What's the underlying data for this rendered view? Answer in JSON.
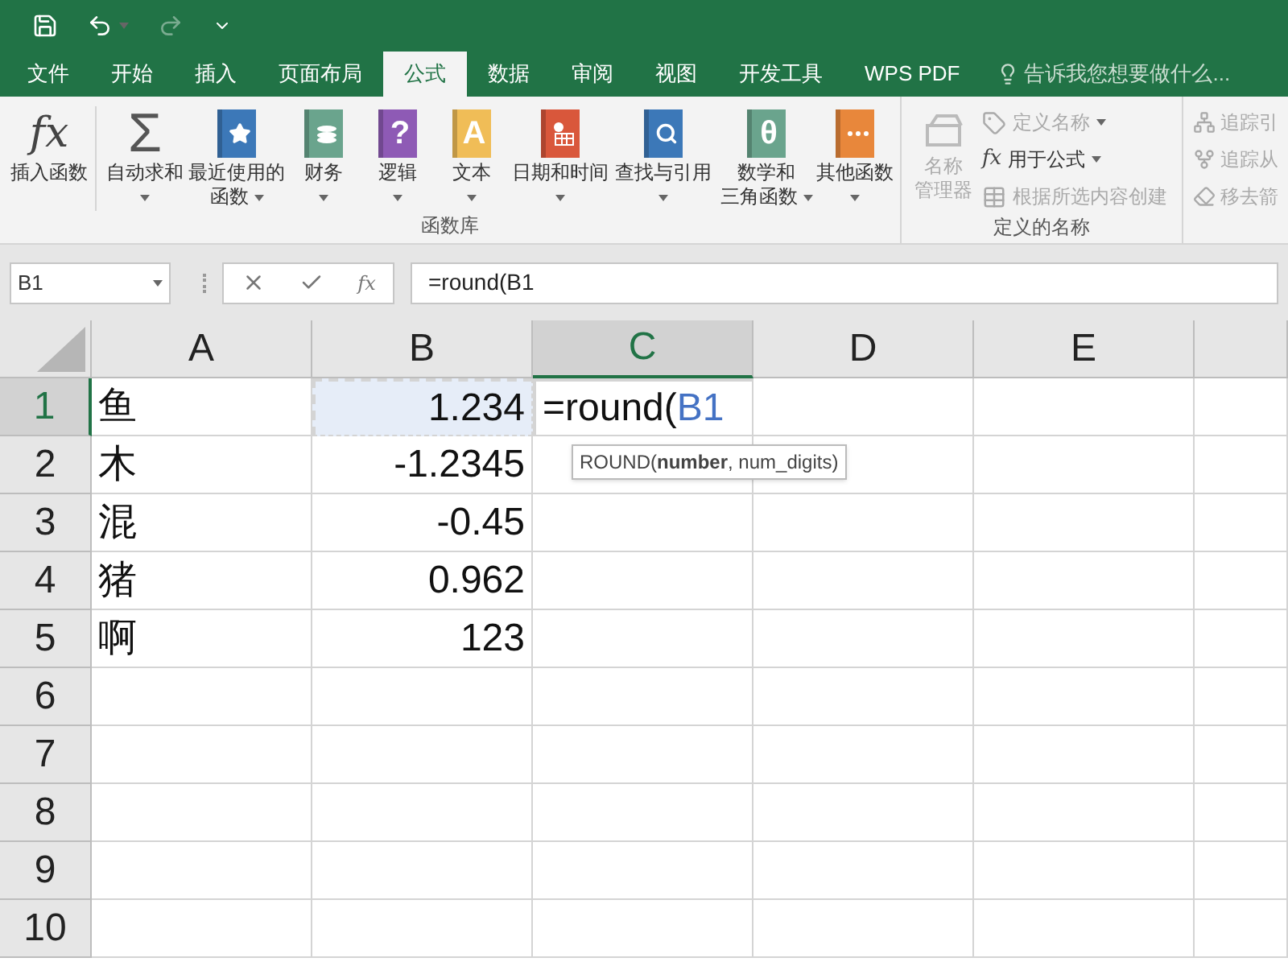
{
  "tabs": [
    {
      "label": "文件",
      "selected": false
    },
    {
      "label": "开始",
      "selected": false
    },
    {
      "label": "插入",
      "selected": false
    },
    {
      "label": "页面布局",
      "selected": false
    },
    {
      "label": "公式",
      "selected": true
    },
    {
      "label": "数据",
      "selected": false
    },
    {
      "label": "审阅",
      "selected": false
    },
    {
      "label": "视图",
      "selected": false
    },
    {
      "label": "开发工具",
      "selected": false
    },
    {
      "label": "WPS PDF",
      "selected": false
    }
  ],
  "tell_me": {
    "placeholder": "告诉我您想要做什么..."
  },
  "ribbon": {
    "function_library": {
      "title": "函数库",
      "items": [
        {
          "kind": "fx",
          "glyph": "fx",
          "lines": [
            "插入函数"
          ],
          "dropdown": false
        },
        {
          "kind": "sigma",
          "glyph": "Σ",
          "lines": [
            "自动求和"
          ],
          "dropdown": true
        },
        {
          "kind": "star",
          "color": "#3c78b8",
          "lines": [
            "最近使用的",
            "函数"
          ],
          "dropdown": true
        },
        {
          "kind": "coins",
          "color": "#6aa48d",
          "lines": [
            "财务"
          ],
          "dropdown": true
        },
        {
          "kind": "glyph",
          "glyph": "?",
          "color": "#8e5ab5",
          "lines": [
            "逻辑"
          ],
          "dropdown": true
        },
        {
          "kind": "glyph",
          "glyph": "A",
          "color": "#f0bd57",
          "lines": [
            "文本"
          ],
          "dropdown": true
        },
        {
          "kind": "calendar",
          "color": "#d9573b",
          "lines": [
            "日期和时间"
          ],
          "dropdown": true
        },
        {
          "kind": "search",
          "color": "#3c78b8",
          "lines": [
            "查找与引用"
          ],
          "dropdown": true
        },
        {
          "kind": "glyph",
          "glyph": "θ",
          "color": "#6aa48d",
          "lines": [
            "数学和",
            "三角函数"
          ],
          "dropdown": true
        },
        {
          "kind": "dots",
          "color": "#e8873b",
          "lines": [
            "其他函数"
          ],
          "dropdown": true
        }
      ]
    },
    "defined_names": {
      "title": "定义的名称",
      "manager": {
        "lines": [
          "名称",
          "管理器"
        ],
        "disabled": true
      },
      "items": [
        {
          "kind": "tag",
          "label": "定义名称",
          "disabled": true,
          "dropdown": true
        },
        {
          "kind": "fx",
          "label": "用于公式",
          "disabled": false,
          "dropdown": true
        },
        {
          "kind": "table",
          "label": "根据所选内容创建",
          "disabled": true,
          "dropdown": false
        }
      ]
    },
    "auditing": {
      "items": [
        {
          "kind": "precedents",
          "label": "追踪引",
          "disabled": true
        },
        {
          "kind": "dependents",
          "label": "追踪从",
          "disabled": true
        },
        {
          "kind": "remove",
          "label": "移去箭",
          "disabled": true
        }
      ]
    }
  },
  "formula_bar": {
    "name_box": "B1",
    "fx": "fx",
    "formula": "=round(B1"
  },
  "columns": [
    {
      "label": "A",
      "selected": false
    },
    {
      "label": "B",
      "selected": false
    },
    {
      "label": "C",
      "selected": true
    },
    {
      "label": "D",
      "selected": false
    },
    {
      "label": "E",
      "selected": false
    }
  ],
  "rows": [
    {
      "header": "1",
      "selected": true,
      "a": "鱼",
      "b": "1.234",
      "b_referenced": true,
      "c_editing": {
        "text": "=round(",
        "reference": "B1"
      }
    },
    {
      "header": "2",
      "selected": false,
      "a": "木",
      "b": "-1.2345",
      "b_referenced": false
    },
    {
      "header": "3",
      "selected": false,
      "a": "混",
      "b": "-0.45",
      "b_referenced": false
    },
    {
      "header": "4",
      "selected": false,
      "a": "猪",
      "b": "0.962",
      "b_referenced": false
    },
    {
      "header": "5",
      "selected": false,
      "a": "啊",
      "b": "123",
      "b_referenced": false
    },
    {
      "header": "6",
      "selected": false
    },
    {
      "header": "7",
      "selected": false
    },
    {
      "header": "8",
      "selected": false
    },
    {
      "header": "9",
      "selected": false
    },
    {
      "header": "10",
      "selected": false
    }
  ],
  "tooltip": "ROUND(**number**, num_digits)"
}
